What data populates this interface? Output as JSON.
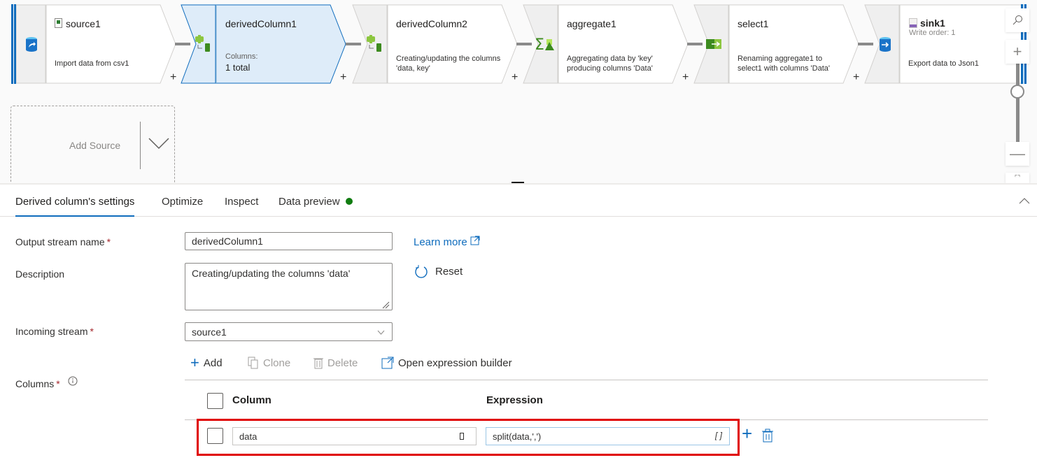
{
  "pipeline": {
    "nodes": [
      {
        "id": "source1",
        "title": "source1",
        "icon": "source-csv-icon",
        "type_icon": "source-database-icon",
        "desc_lines": [
          "Import data from csv1"
        ],
        "selected": false
      },
      {
        "id": "derivedColumn1",
        "title": "derivedColumn1",
        "type_icon": "derived-column-icon",
        "desc_lines": [
          "Columns:"
        ],
        "emphasis": "1 total",
        "selected": true
      },
      {
        "id": "derivedColumn2",
        "title": "derivedColumn2",
        "type_icon": "derived-column-icon",
        "desc_lines": [
          "Creating/updating the columns",
          "'data, key'"
        ],
        "selected": false
      },
      {
        "id": "aggregate1",
        "title": "aggregate1",
        "type_icon": "aggregate-icon",
        "desc_lines": [
          "Aggregating data by 'key'",
          "producing columns 'Data'"
        ],
        "selected": false
      },
      {
        "id": "select1",
        "title": "select1",
        "type_icon": "select-icon",
        "desc_lines": [
          "Renaming aggregate1 to",
          "select1 with columns 'Data'"
        ],
        "selected": false
      },
      {
        "id": "sink1",
        "title": "sink1",
        "icon": "sink-json-icon",
        "type_icon": "sink-database-icon",
        "subtitle": "Write order: 1",
        "desc_lines": [
          "Export data to Json1"
        ],
        "selected": false
      }
    ],
    "add_node_symbol": "+",
    "add_source_label": "Add Source",
    "zoom_controls": {
      "search": "search-icon",
      "zoom_in": "+",
      "zoom_out": "—",
      "fit": "fit-icon",
      "zoom_level": 0.7
    }
  },
  "panel": {
    "tabs": [
      {
        "label": "Derived column's settings",
        "active": true
      },
      {
        "label": "Optimize",
        "active": false
      },
      {
        "label": "Inspect",
        "active": false
      },
      {
        "label": "Data preview",
        "active": false,
        "status_color": "#107c10"
      }
    ],
    "form": {
      "output_stream_name": {
        "label": "Output stream name",
        "required": "*",
        "value": "derivedColumn1"
      },
      "description": {
        "label": "Description",
        "value": "Creating/updating the columns 'data'"
      },
      "incoming_stream": {
        "label": "Incoming stream",
        "required": "*",
        "value": "source1"
      },
      "columns": {
        "label": "Columns",
        "required": "*"
      },
      "learn_more": "Learn more",
      "reset": "Reset"
    },
    "toolbar": {
      "add": "Add",
      "clone": "Clone",
      "delete": "Delete",
      "open_builder": "Open expression builder"
    },
    "table": {
      "headers": {
        "column": "Column",
        "expression": "Expression"
      },
      "rows": [
        {
          "column": "data",
          "expression": "split(data,',')",
          "type_glyph": "[ ]"
        }
      ]
    }
  },
  "colors": {
    "accent": "#0f6cbd",
    "selected_node_bg": "#deecf9",
    "highlight": "#e00000"
  }
}
